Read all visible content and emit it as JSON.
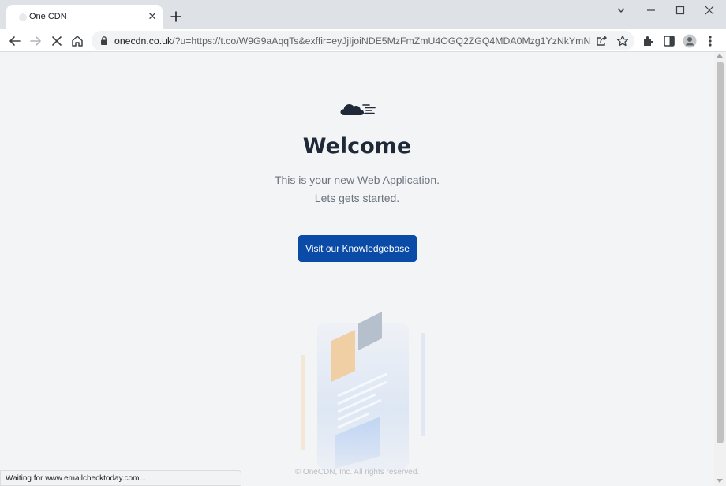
{
  "browser": {
    "tab": {
      "title": "One CDN"
    },
    "address": {
      "host": "onecdn.co.uk",
      "path": "/?u=https://t.co/W9G9aAqqTs&exffir=eyJjIjoiNDE5MzFmZmU4OGQ2ZGQ4MDA0Mzg1YzNkYmNlMzBm..."
    },
    "status": "Waiting for www.emailchecktoday.com..."
  },
  "page": {
    "heading": "Welcome",
    "subtext_line1": "This is your new Web Application.",
    "subtext_line2": "Lets gets started.",
    "button_label": "Visit our Knowledgebase",
    "footer": "© OneCDN, Inc. All rights reserved."
  },
  "colors": {
    "primary_button": "#0b4ba8",
    "heading": "#1f2937",
    "logo": "#1f2937"
  },
  "icons": {
    "back": "arrow-left-icon",
    "forward": "arrow-right-icon",
    "stop": "close-icon",
    "home": "home-icon",
    "lock": "lock-icon",
    "share": "share-icon",
    "bookmark": "star-icon",
    "extensions": "puzzle-icon",
    "side_panel": "side-panel-icon",
    "profile": "profile-icon",
    "menu": "kebab-menu-icon"
  }
}
